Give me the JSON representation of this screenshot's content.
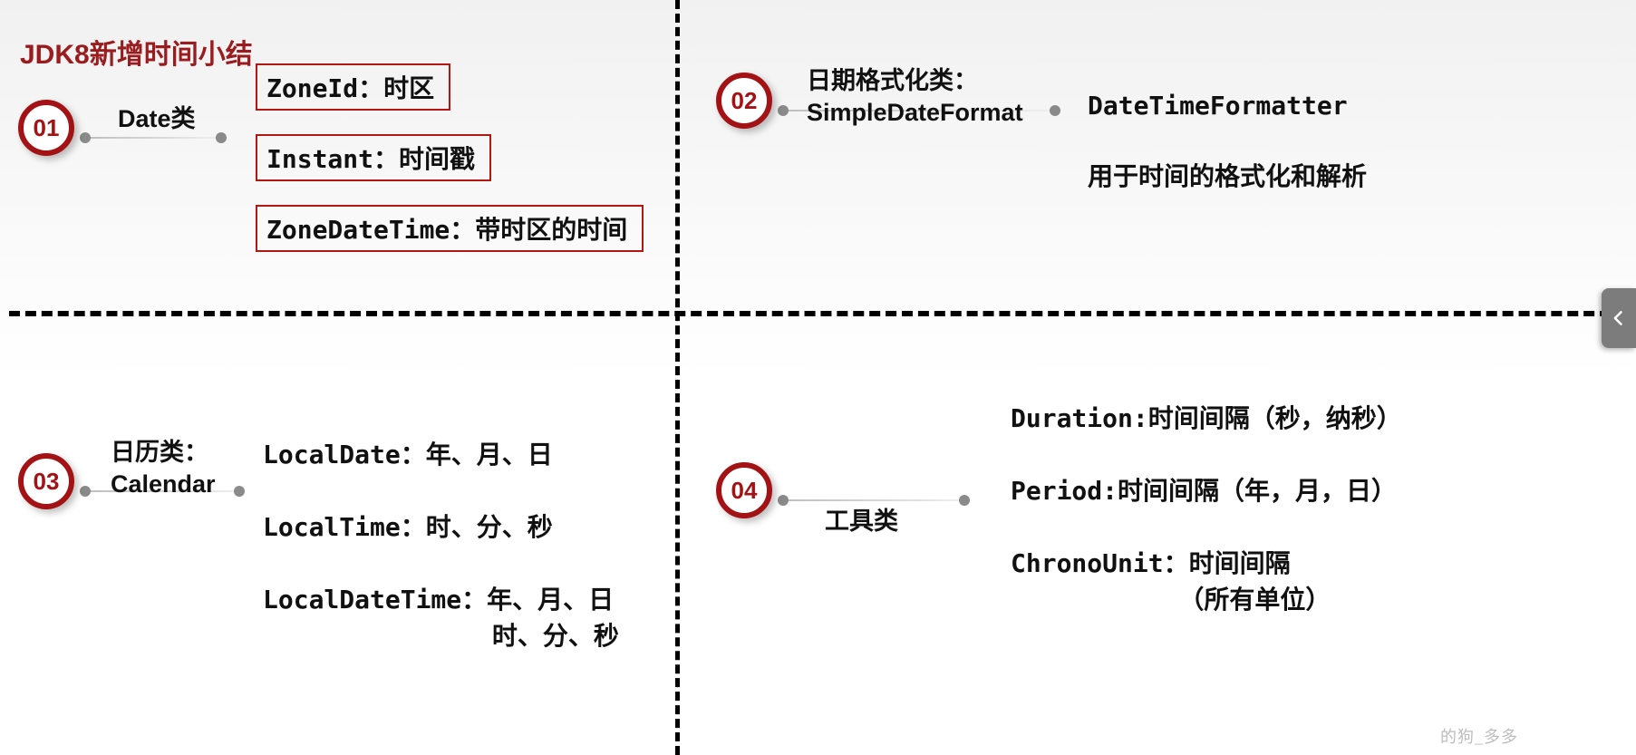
{
  "title": "JDK8新增时间小结",
  "sections": {
    "s1": {
      "num": "01",
      "label": "Date类",
      "items": [
        "ZoneId：时区",
        "Instant：时间戳",
        "ZoneDateTime：带时区的时间"
      ]
    },
    "s2": {
      "num": "02",
      "label": "日期格式化类：\nSimpleDateFormat",
      "items": [
        "DateTimeFormatter",
        "用于时间的格式化和解析"
      ]
    },
    "s3": {
      "num": "03",
      "label": "日历类：\nCalendar",
      "items": [
        "LocalDate：年、月、日",
        "LocalTime：时、分、秒",
        "LocalDateTime：年、月、日\n               时、分、秒"
      ]
    },
    "s4": {
      "num": "04",
      "label": "工具类",
      "items": [
        "Duration:时间间隔（秒，纳秒）",
        "Period:时间间隔（年，月，日）",
        "ChronoUnit：时间间隔\n           （所有单位）"
      ]
    }
  },
  "watermark": "的狗_多多"
}
